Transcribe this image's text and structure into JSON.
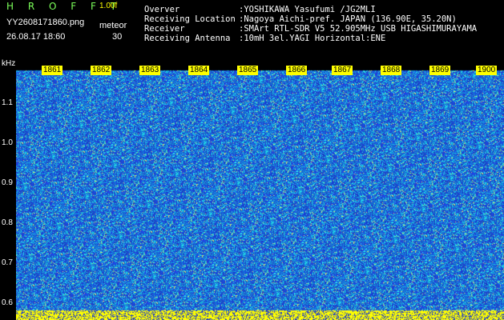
{
  "header": {
    "app_title": "H R O F F T",
    "version": "1.00f",
    "filename": "YY2608171860.png",
    "meteor_label": "meteor",
    "timestamp": "26.08.17 18:60",
    "meteor_count": "30"
  },
  "info": [
    {
      "label": "Overver",
      "value": ":YOSHIKAWA Yasufumi /JG2MLI"
    },
    {
      "label": "Receiving Location",
      "value": ":Nagoya Aichi-pref. JAPAN (136.90E, 35.20N)"
    },
    {
      "label": "Receiver",
      "value": ":SMArt RTL-SDR V5 52.905MHz USB HIGASHIMURAYAMA"
    },
    {
      "label": "Receiving Antenna",
      "value": ":10mH 3el.YAGI Horizontal:ENE"
    }
  ],
  "axis": {
    "unit": "kHz",
    "y_ticks": [
      "1.1",
      "1.0",
      "0.9",
      "0.8",
      "0.7",
      "0.6"
    ],
    "x_ticks": [
      "1861",
      "1862",
      "1863",
      "1864",
      "1865",
      "1866",
      "1867",
      "1868",
      "1869",
      "1900"
    ]
  },
  "colors": {
    "background": "#000000",
    "spectrum_base": "#1a3cc8",
    "spectrum_noise": "#19d2e6",
    "spectrum_hot": "#ffff00",
    "title": "#7CFF5A"
  }
}
